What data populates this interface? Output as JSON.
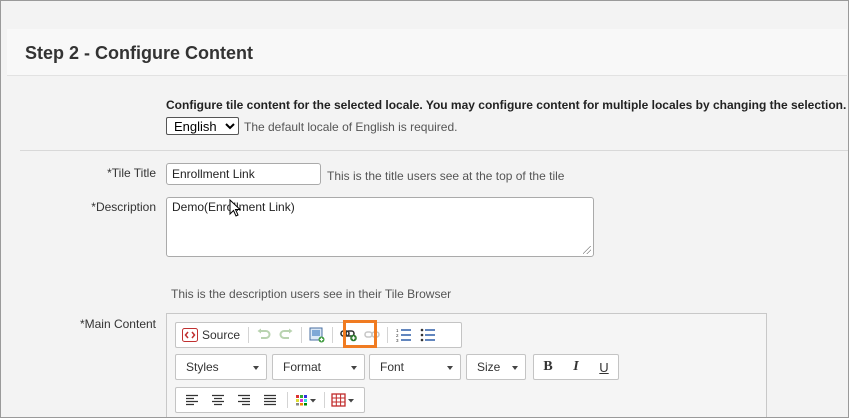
{
  "page": {
    "step_title": "Step 2 - Configure Content"
  },
  "locale": {
    "instruction": "Configure tile content for the selected locale. You may configure content for multiple locales by changing the selection.",
    "selected": "English",
    "hint": "The default locale of English is required."
  },
  "tile_title": {
    "label": "*Tile Title",
    "value": "Enrollment Link",
    "hint": "This is the title users see at the top of the tile"
  },
  "description": {
    "label": "*Description",
    "value": "Demo(Enrollment Link)",
    "hint": "This is the description users see in their Tile Browser"
  },
  "main_content": {
    "label": "*Main Content"
  },
  "editor": {
    "source_label": "Source",
    "styles_label": "Styles",
    "format_label": "Format",
    "font_label": "Font",
    "size_label": "Size",
    "bold_label": "B",
    "italic_label": "I",
    "underline_label": "U"
  },
  "colors": {
    "highlight": "#f07b21",
    "link_icon": "#2c7a2c"
  }
}
